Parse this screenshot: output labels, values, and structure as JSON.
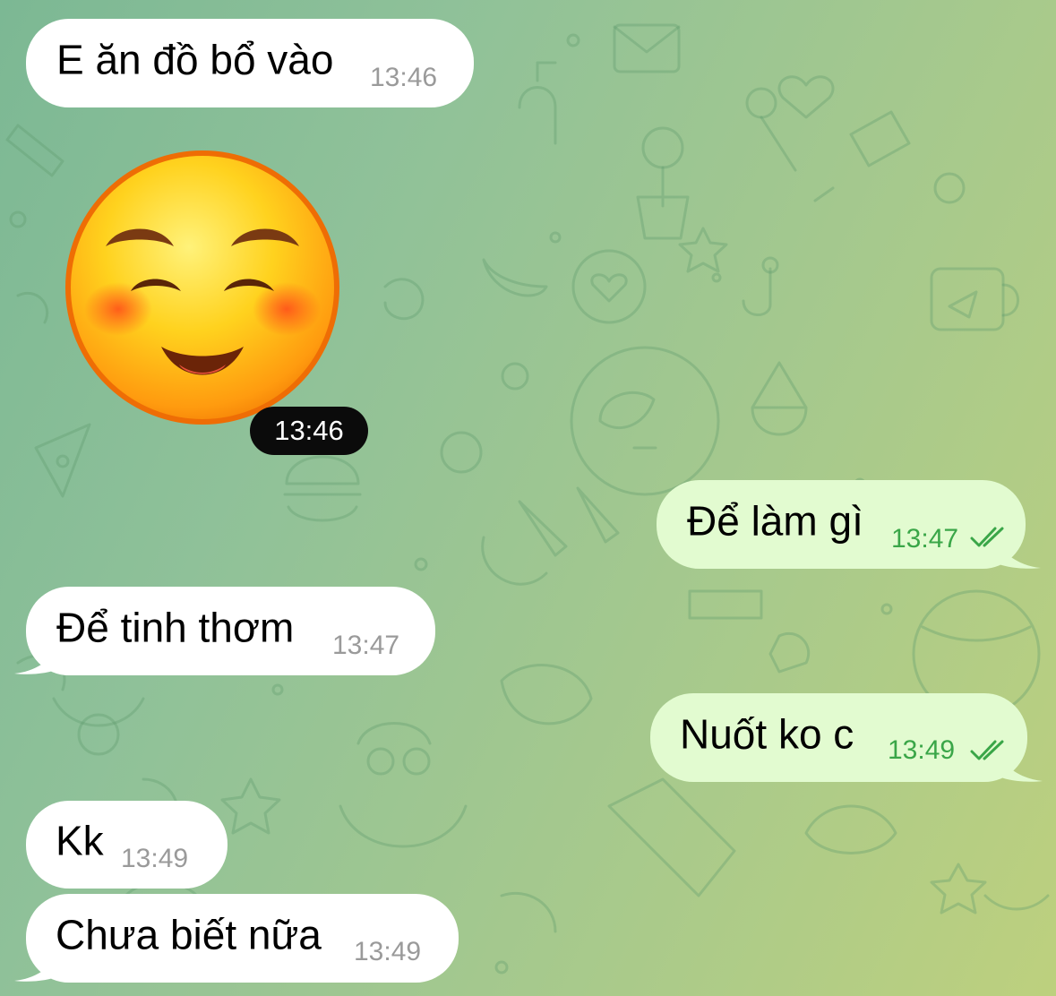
{
  "chat": {
    "messages": [
      {
        "text": "E ăn đồ bổ vào",
        "time": "13:46",
        "direction": "incoming"
      },
      {
        "sticker": "smiling-face-with-smiling-eyes",
        "time": "13:46",
        "direction": "incoming"
      },
      {
        "text": "Để làm gì",
        "time": "13:47",
        "direction": "outgoing",
        "status": "read"
      },
      {
        "text": "Để tinh thơm",
        "time": "13:47",
        "direction": "incoming"
      },
      {
        "text": "Nuốt ko c",
        "time": "13:49",
        "direction": "outgoing",
        "status": "read"
      },
      {
        "text": "Kk",
        "time": "13:49",
        "direction": "incoming"
      },
      {
        "text": "Chưa biết nữa",
        "time": "13:49",
        "direction": "incoming"
      }
    ]
  },
  "colors": {
    "incoming_bubble": "#ffffff",
    "outgoing_bubble": "#e2fbd0",
    "outgoing_time": "#3aa648",
    "incoming_time": "#9a9a9a",
    "background_start": "#7cb894",
    "background_end": "#bdd07e"
  },
  "icons": {
    "read_status": "double-check-icon",
    "sticker": "smiling-face-sticker"
  }
}
